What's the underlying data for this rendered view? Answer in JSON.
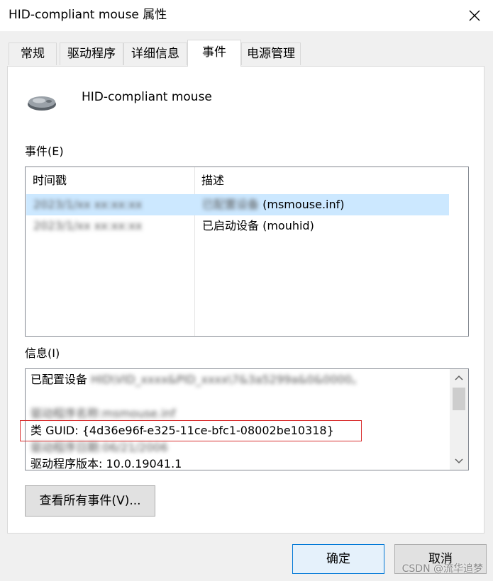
{
  "window": {
    "title": "HID-compliant mouse 属性"
  },
  "tabs": [
    {
      "label": "常规",
      "active": false
    },
    {
      "label": "驱动程序",
      "active": false
    },
    {
      "label": "详细信息",
      "active": false
    },
    {
      "label": "事件",
      "active": true
    },
    {
      "label": "电源管理",
      "active": false
    }
  ],
  "device": {
    "name": "HID-compliant mouse",
    "icon": "mouse-icon"
  },
  "events": {
    "label": "事件(E)",
    "columns": [
      "时间戳",
      "描述"
    ],
    "rows": [
      {
        "timestamp": "2023/1/xx xx:xx:xx",
        "description_hidden": "已配置设备",
        "description": "(msmouse.inf)",
        "selected": true
      },
      {
        "timestamp": "2023/1/xx xx:xx:xx",
        "description_hidden": "",
        "description": "已启动设备 (mouhid)",
        "selected": false
      }
    ]
  },
  "info": {
    "label": "信息(I)",
    "lines": [
      {
        "prefix": "已配置设备",
        "blurred": "HID\\VID_xxxx&PID_xxxx\\7&3a5299a&0&0000。"
      },
      {
        "prefix": "",
        "blurred": ""
      },
      {
        "prefix": "驱动程序名称: ",
        "blurred": "msmouse.inf"
      },
      {
        "prefix": "类 GUID: {4d36e96f-e325-11ce-bfc1-08002be10318}",
        "blurred": ""
      },
      {
        "prefix": "驱动程序日期: ",
        "blurred": "06/21/2006"
      },
      {
        "prefix": "驱动程序版本: 10.0.19041.1",
        "blurred": ""
      }
    ]
  },
  "buttons": {
    "view_all": "查看所有事件(V)...",
    "ok": "确定",
    "cancel": "取消"
  },
  "watermark": "CSDN @流华追梦",
  "colors": {
    "selection": "#cce8ff",
    "highlight_border": "#d93030",
    "default_button_border": "#0078d7"
  }
}
